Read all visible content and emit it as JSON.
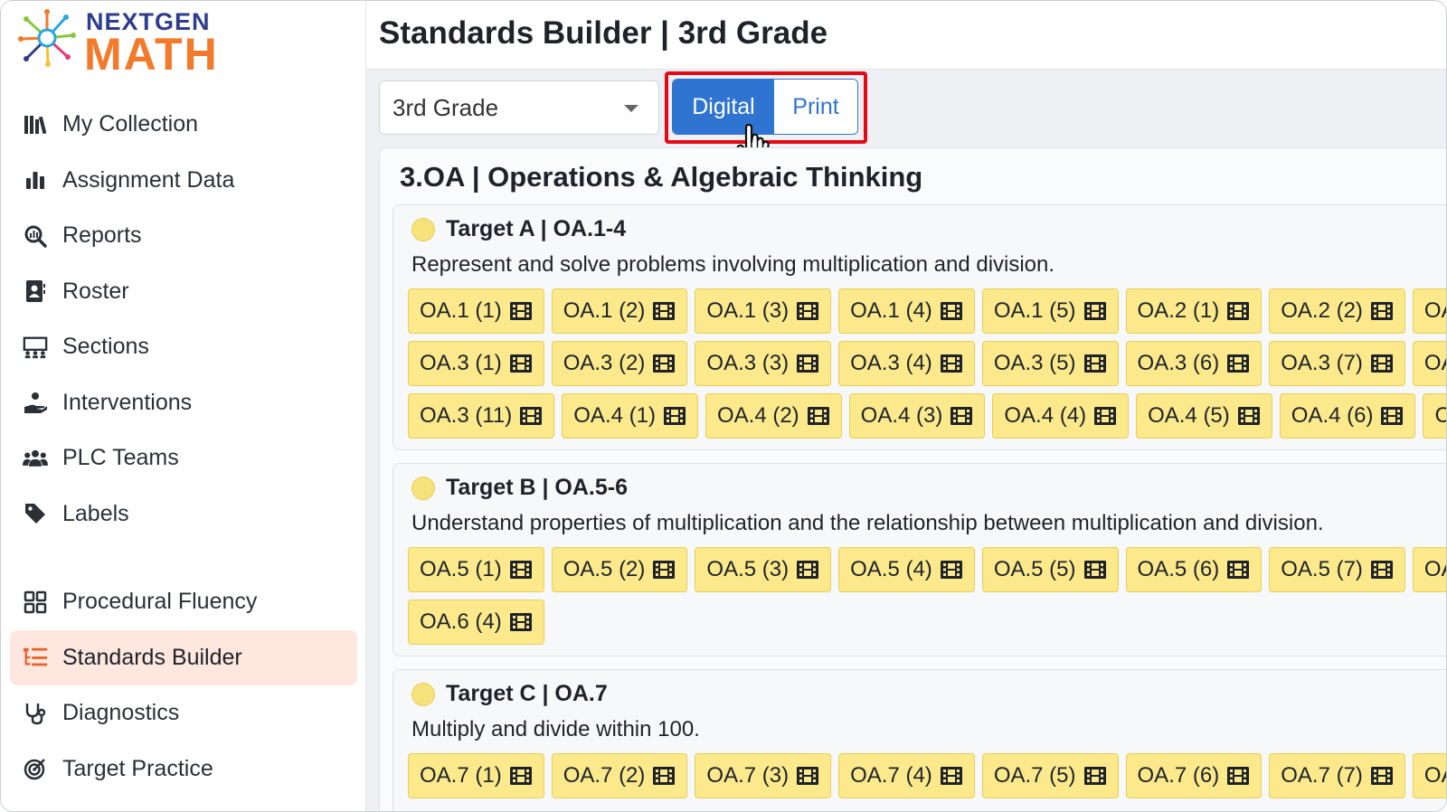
{
  "app": {
    "logo_top": "NEXTGEN",
    "logo_bottom": "MATH",
    "page_title": "Standards Builder | 3rd Grade"
  },
  "sidebar": {
    "items": [
      {
        "label": "My Collection",
        "icon": "books-icon"
      },
      {
        "label": "Assignment Data",
        "icon": "bar-chart-icon"
      },
      {
        "label": "Reports",
        "icon": "magnify-chart-icon"
      },
      {
        "label": "Roster",
        "icon": "contact-card-icon"
      },
      {
        "label": "Sections",
        "icon": "classroom-icon"
      },
      {
        "label": "Interventions",
        "icon": "hand-helping-icon"
      },
      {
        "label": "PLC Teams",
        "icon": "users-icon"
      },
      {
        "label": "Labels",
        "icon": "tag-icon"
      }
    ],
    "items2": [
      {
        "label": "Procedural Fluency",
        "icon": "grid-icon"
      },
      {
        "label": "Standards Builder",
        "icon": "list-tree-icon",
        "active": true
      },
      {
        "label": "Diagnostics",
        "icon": "stethoscope-icon"
      },
      {
        "label": "Target Practice",
        "icon": "target-icon"
      }
    ]
  },
  "toolbar": {
    "grade_value": "3rd Grade",
    "toggle_digital": "Digital",
    "toggle_print": "Print"
  },
  "domain": {
    "title": "3.OA | Operations & Algebraic Thinking"
  },
  "targets": [
    {
      "title": "Target A | OA.1-4",
      "description": "Represent and solve problems involving multiplication and division.",
      "rows": [
        [
          "OA.1 (1)",
          "OA.1 (2)",
          "OA.1 (3)",
          "OA.1 (4)",
          "OA.1 (5)",
          "OA.2 (1)",
          "OA.2 (2)",
          "OA"
        ],
        [
          "OA.3 (1)",
          "OA.3 (2)",
          "OA.3 (3)",
          "OA.3 (4)",
          "OA.3 (5)",
          "OA.3 (6)",
          "OA.3 (7)",
          "OA"
        ],
        [
          "OA.3 (11)",
          "OA.4 (1)",
          "OA.4 (2)",
          "OA.4 (3)",
          "OA.4 (4)",
          "OA.4 (5)",
          "OA.4 (6)",
          "C"
        ]
      ]
    },
    {
      "title": "Target B | OA.5-6",
      "description": "Understand properties of multiplication and the relationship between multiplication and division.",
      "rows": [
        [
          "OA.5 (1)",
          "OA.5 (2)",
          "OA.5 (3)",
          "OA.5 (4)",
          "OA.5 (5)",
          "OA.5 (6)",
          "OA.5 (7)",
          "OA"
        ],
        [
          "OA.6 (4)"
        ]
      ]
    },
    {
      "title": "Target C | OA.7",
      "description": "Multiply and divide within 100.",
      "rows": [
        [
          "OA.7 (1)",
          "OA.7 (2)",
          "OA.7 (3)",
          "OA.7 (4)",
          "OA.7 (5)",
          "OA.7 (6)",
          "OA.7 (7)",
          "OA"
        ]
      ]
    }
  ],
  "colors": {
    "accent": "#e8632b",
    "primary": "#2f74d0",
    "chip": "#fbe98c",
    "highlight": "#e50914"
  }
}
